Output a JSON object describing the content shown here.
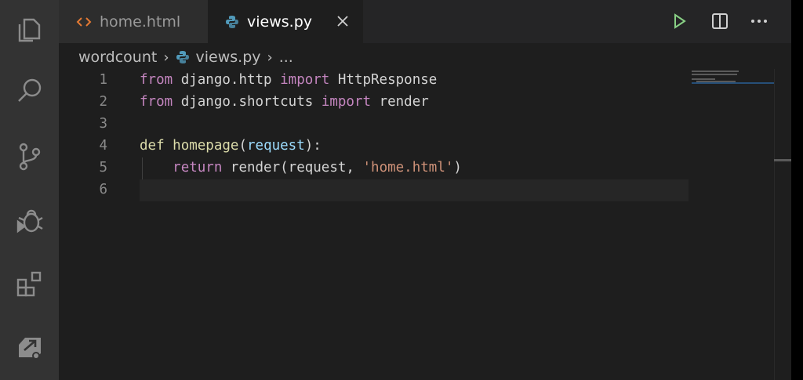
{
  "tabs": [
    {
      "label": "home.html",
      "icon": "html-icon",
      "active": false
    },
    {
      "label": "views.py",
      "icon": "python-icon",
      "active": true
    }
  ],
  "breadcrumb": {
    "folder": "wordcount",
    "file": "views.py",
    "more": "..."
  },
  "code_lines": [
    {
      "num": "1",
      "segments": [
        [
          "from",
          "kw"
        ],
        [
          " django.http ",
          ""
        ],
        [
          "import",
          "kw"
        ],
        [
          " HttpResponse",
          ""
        ]
      ]
    },
    {
      "num": "2",
      "segments": [
        [
          "from",
          "kw"
        ],
        [
          " django.shortcuts ",
          ""
        ],
        [
          "import",
          "kw"
        ],
        [
          " render",
          ""
        ]
      ]
    },
    {
      "num": "3",
      "segments": []
    },
    {
      "num": "4",
      "segments": [
        [
          "def",
          "def"
        ],
        [
          " ",
          ""
        ],
        [
          "homepage",
          "fn"
        ],
        [
          "(",
          ""
        ],
        [
          "request",
          "param"
        ],
        [
          "):",
          ""
        ]
      ]
    },
    {
      "num": "5",
      "segments": [
        [
          "    ",
          ""
        ],
        [
          "return",
          "kwr"
        ],
        [
          " render(request, ",
          ""
        ],
        [
          "'home.html'",
          "str"
        ],
        [
          ")",
          ""
        ]
      ]
    },
    {
      "num": "6",
      "segments": []
    }
  ],
  "colors": {
    "background": "#1e1e1e",
    "activity_bar": "#333333",
    "keyword": "#c586c0",
    "function": "#dcdcaa",
    "string": "#ce9178",
    "param": "#9cdcfe",
    "run_green": "#89d185"
  },
  "activity_icons": [
    "explorer-icon",
    "search-icon",
    "source-control-icon",
    "debug-icon",
    "extensions-icon",
    "remote-icon"
  ],
  "toolbar_icons": [
    "run-icon",
    "split-editor-icon",
    "more-actions-icon"
  ]
}
